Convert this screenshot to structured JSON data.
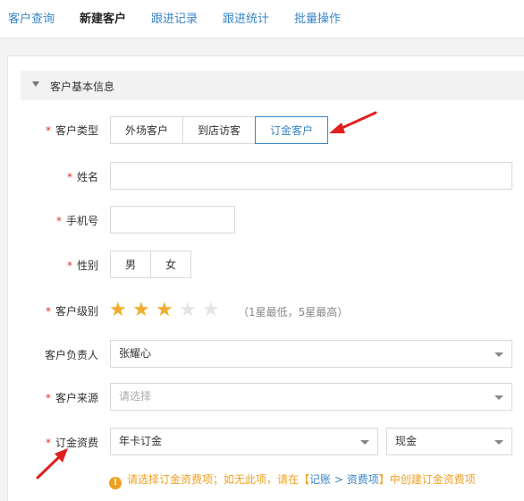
{
  "nav": {
    "tabs": [
      "客户查询",
      "新建客户",
      "跟进记录",
      "跟进统计",
      "批量操作"
    ],
    "active": "新建客户"
  },
  "section": {
    "title": "客户基本信息",
    "toggle_icon": "triangle-down-icon"
  },
  "form": {
    "customer_type": {
      "label": "客户类型",
      "required": "*",
      "options": [
        "外场客户",
        "到店访客",
        "订金客户"
      ],
      "selected": "订金客户"
    },
    "name": {
      "label": "姓名",
      "required": "*",
      "value": ""
    },
    "phone": {
      "label": "手机号",
      "required": "*",
      "value": ""
    },
    "gender": {
      "label": "性别",
      "required": "*",
      "options": [
        "男",
        "女"
      ]
    },
    "level": {
      "label": "客户级别",
      "required": "*",
      "rating": 3,
      "max": 5,
      "hint": "（1星最低，5星最高）"
    },
    "owner": {
      "label": "客户负责人",
      "value": "张耀心"
    },
    "source": {
      "label": "客户来源",
      "required": "*",
      "placeholder": "请选择"
    },
    "deposit": {
      "label": "订金资费",
      "required": "*",
      "plan": "年卡订金",
      "payment": "现金"
    }
  },
  "notice": {
    "icon": "warning-icon",
    "text_before": "请选择订金资费项；如无此项，请在【",
    "link": "记账 > 资费项",
    "text_after": "】中创建订金资费项"
  },
  "colors": {
    "accent": "#3a86c8",
    "star": "#f0ad2b",
    "required": "#d9362b",
    "notice": "#f0a020",
    "annotation_arrow": "#e02020"
  }
}
